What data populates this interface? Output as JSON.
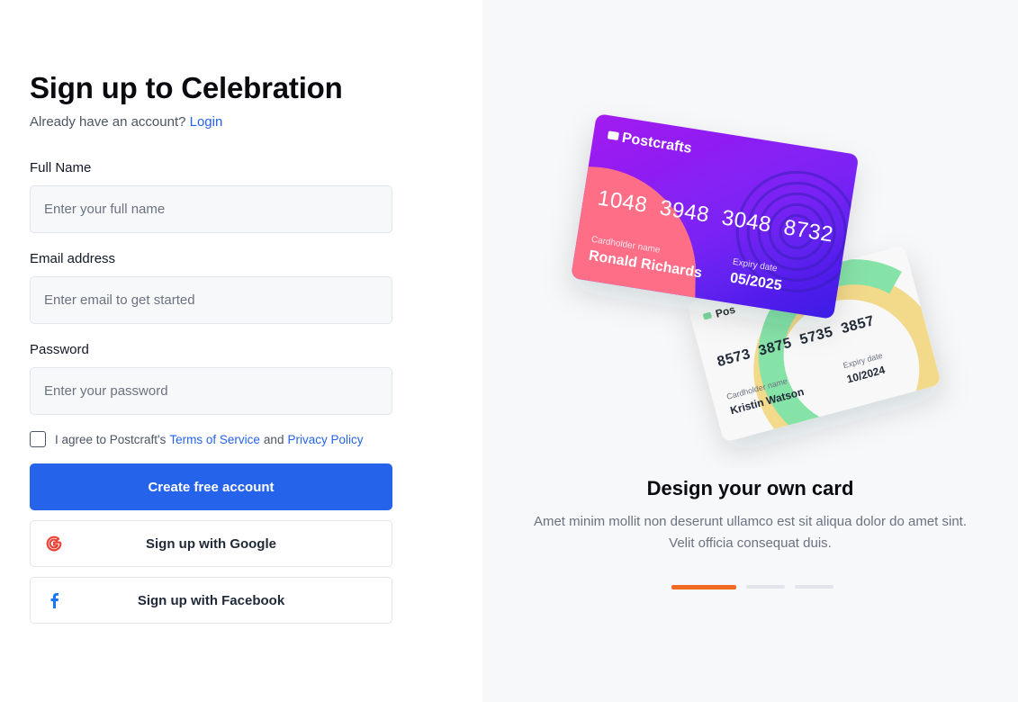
{
  "signup": {
    "title": "Sign up to Celebration",
    "subtitle_prefix": "Already have an account?",
    "login_link": "Login",
    "full_name": {
      "label": "Full Name",
      "placeholder": "Enter your full name"
    },
    "email": {
      "label": "Email address",
      "placeholder": "Enter email to get started"
    },
    "password": {
      "label": "Password",
      "placeholder": "Enter your password"
    },
    "agree": {
      "prefix": "I agree to Postcraft's",
      "terms": "Terms of Service",
      "and": "and",
      "privacy": "Privacy Policy",
      "checked": false
    },
    "create_button": "Create free account",
    "google_button": "Sign up with Google",
    "facebook_button": "Sign up with Facebook"
  },
  "promo": {
    "front_card": {
      "brand": "Postcrafts",
      "number": "1048  3948  3048  8732",
      "holder_label": "Cardholder name",
      "holder": "Ronald Richards",
      "expiry_label": "Expiry date",
      "expiry": "05/2025"
    },
    "back_card": {
      "brand": "Pos",
      "number": "8573  3875  5735  3857",
      "holder_label": "Cardholder name",
      "holder": "Kristin Watson",
      "expiry_label": "Expiry date",
      "expiry": "10/2024"
    },
    "title": "Design your own card",
    "description_line1": "Amet minim mollit non deserunt ullamco est sit aliqua dolor do amet sint.",
    "description_line2": "Velit officia consequat duis.",
    "carousel_active_index": 0,
    "carousel_count": 3
  },
  "colors": {
    "primary": "#2563eb",
    "accent": "#f06a24",
    "google_red": "#ea4335",
    "facebook_blue": "#1877f2"
  },
  "icons": {
    "google": "google-icon",
    "facebook": "facebook-icon"
  }
}
